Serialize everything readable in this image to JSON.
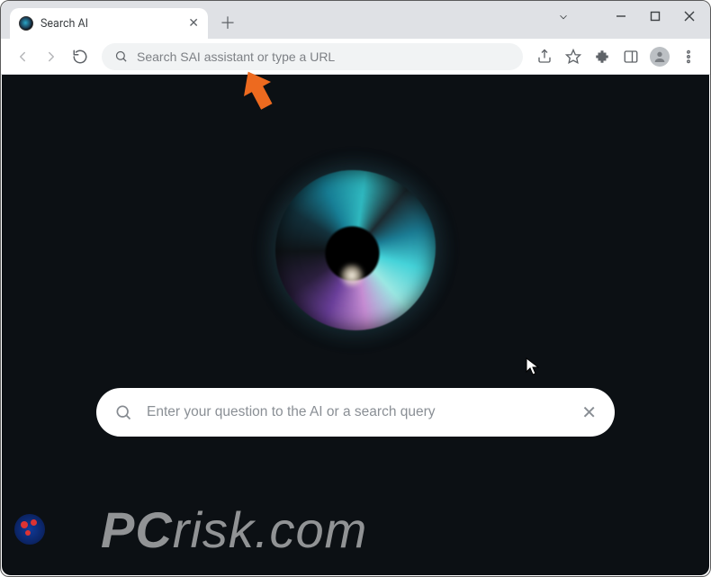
{
  "window": {
    "tab_title": "Search AI"
  },
  "omnibox": {
    "placeholder": "Search SAI assistant or type a URL"
  },
  "page": {
    "search_placeholder": "Enter your question to the AI or a search query"
  },
  "watermark": {
    "brand_bold": "PC",
    "brand_rest": "risk.com"
  }
}
